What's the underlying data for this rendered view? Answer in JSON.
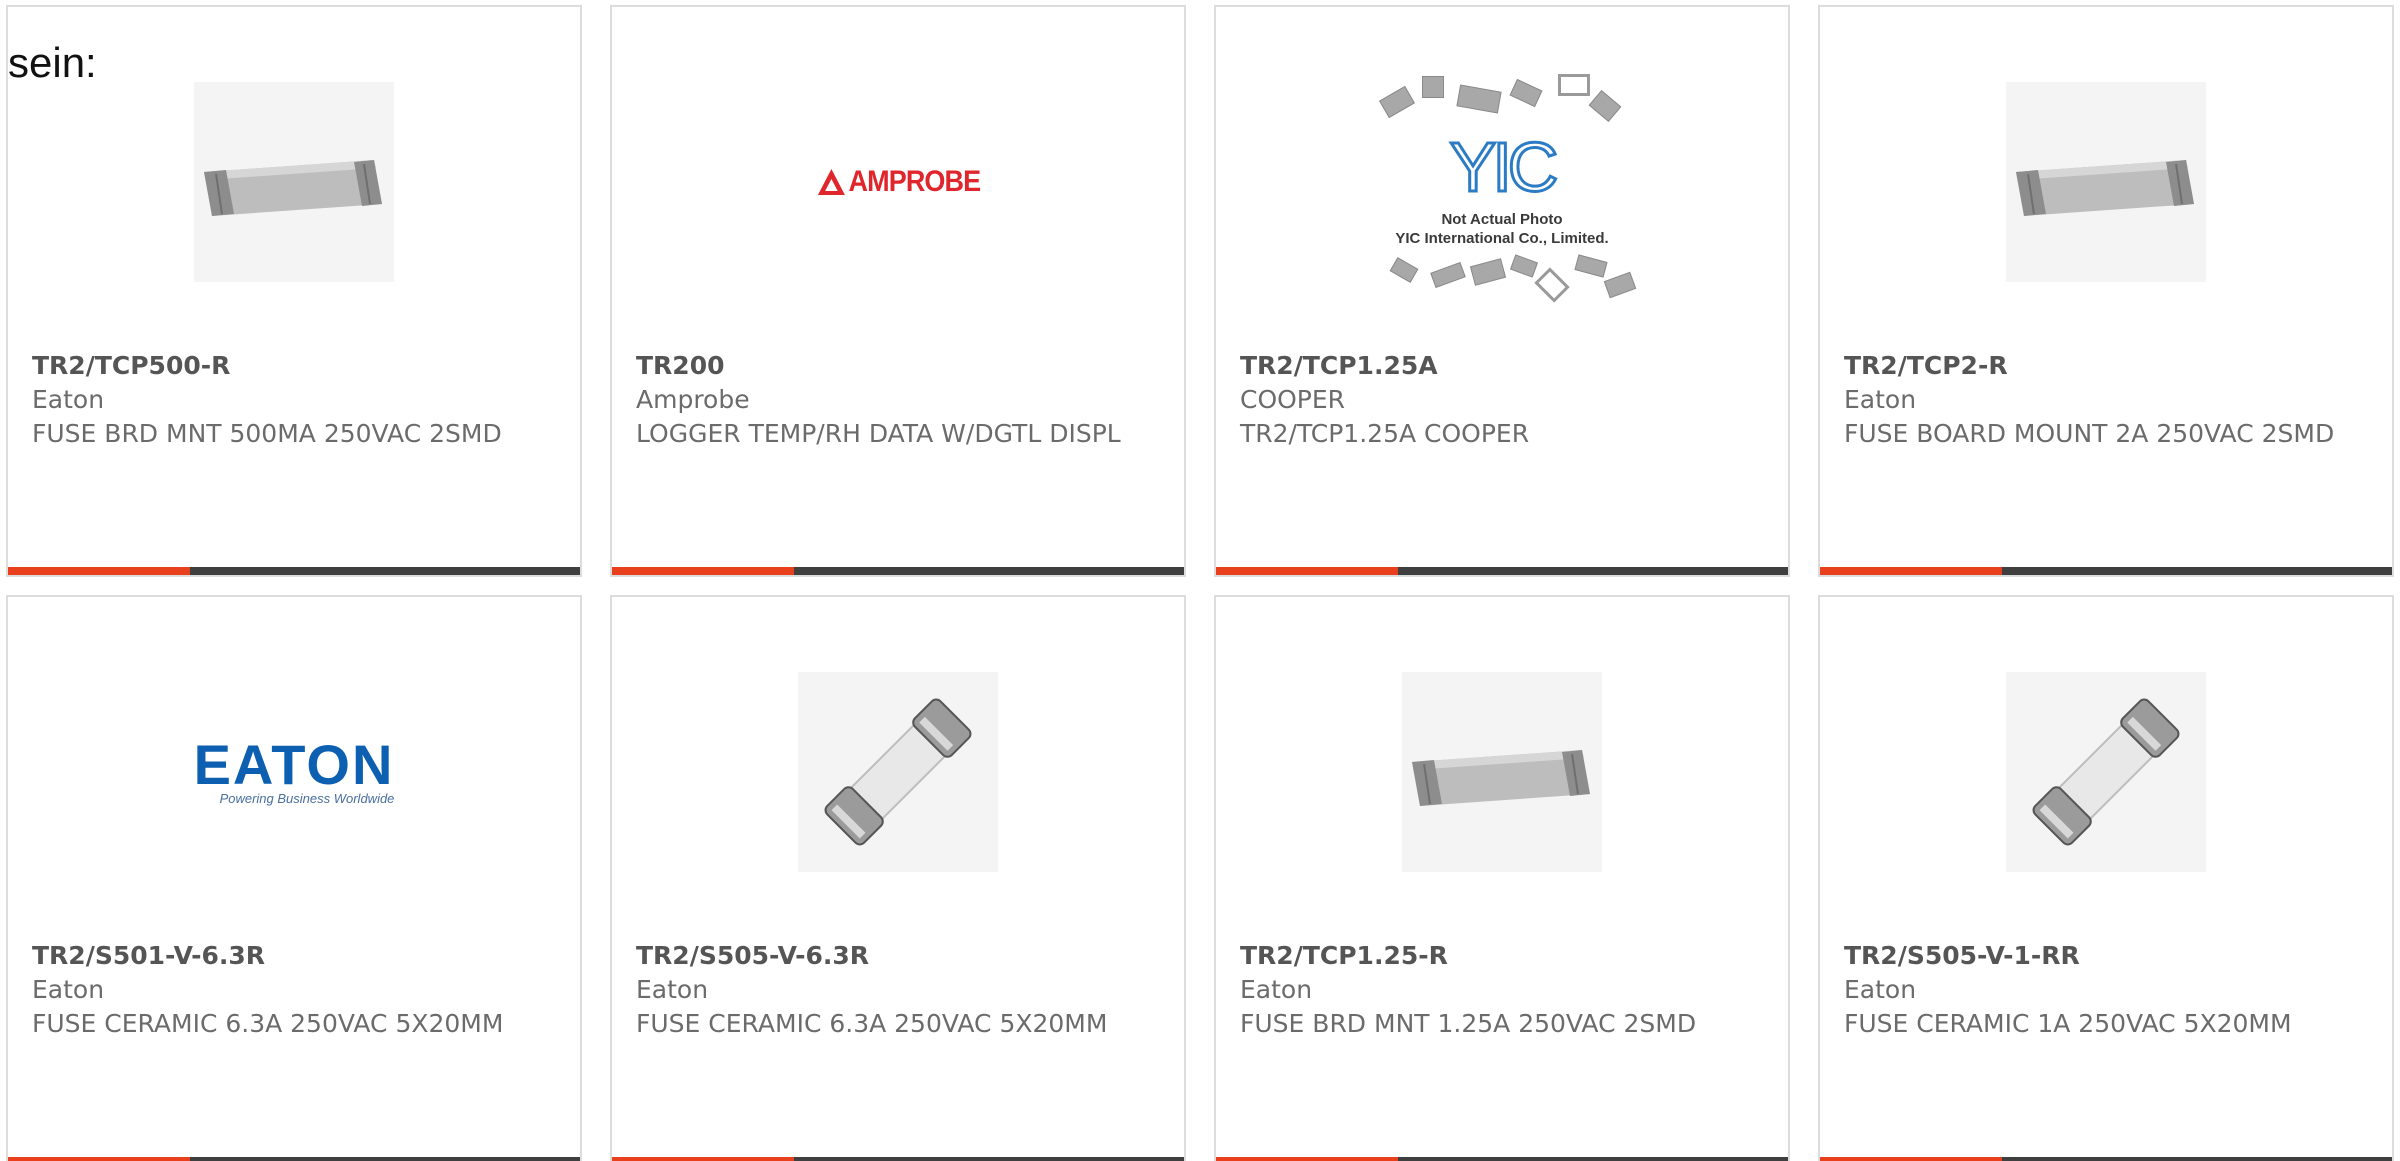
{
  "prefix_text": "sein:",
  "colors": {
    "accent": "#e8401c",
    "bar": "#3f3f3f",
    "eaton_blue": "#0d5fb1",
    "amprobe_red": "#e0262d",
    "yic_blue": "#2b7cc4"
  },
  "products": [
    {
      "part_number": "TR2/TCP500-R",
      "manufacturer": "Eaton",
      "description": "FUSE BRD MNT 500MA 250VAC 2SMD",
      "image": "board-mount-fuse-photo"
    },
    {
      "part_number": "TR200",
      "manufacturer": "Amprobe",
      "description": "LOGGER TEMP/RH DATA W/DGTL DISPL",
      "image": "amprobe-logo",
      "logo_text": "AMPROBE"
    },
    {
      "part_number": "TR2/TCP1.25A",
      "manufacturer": "COOPER",
      "description": "TR2/TCP1.25A COOPER",
      "image": "yic-placeholder",
      "logo_text": "YIC",
      "note_line1": "Not Actual Photo",
      "note_line2": "YIC International Co., Limited."
    },
    {
      "part_number": "TR2/TCP2-R",
      "manufacturer": "Eaton",
      "description": "FUSE BOARD MOUNT 2A 250VAC 2SMD",
      "image": "board-mount-fuse-photo"
    },
    {
      "part_number": "TR2/S501-V-6.3R",
      "manufacturer": "Eaton",
      "description": "FUSE CERAMIC 6.3A 250VAC 5X20MM",
      "image": "eaton-logo",
      "logo_text": "EATON",
      "logo_tagline": "Powering Business Worldwide"
    },
    {
      "part_number": "TR2/S505-V-6.3R",
      "manufacturer": "Eaton",
      "description": "FUSE CERAMIC 6.3A 250VAC 5X20MM",
      "image": "cartridge-fuse-photo"
    },
    {
      "part_number": "TR2/TCP1.25-R",
      "manufacturer": "Eaton",
      "description": "FUSE BRD MNT 1.25A 250VAC 2SMD",
      "image": "board-mount-fuse-photo"
    },
    {
      "part_number": "TR2/S505-V-1-RR",
      "manufacturer": "Eaton",
      "description": "FUSE CERAMIC 1A 250VAC 5X20MM",
      "image": "cartridge-fuse-photo"
    }
  ]
}
